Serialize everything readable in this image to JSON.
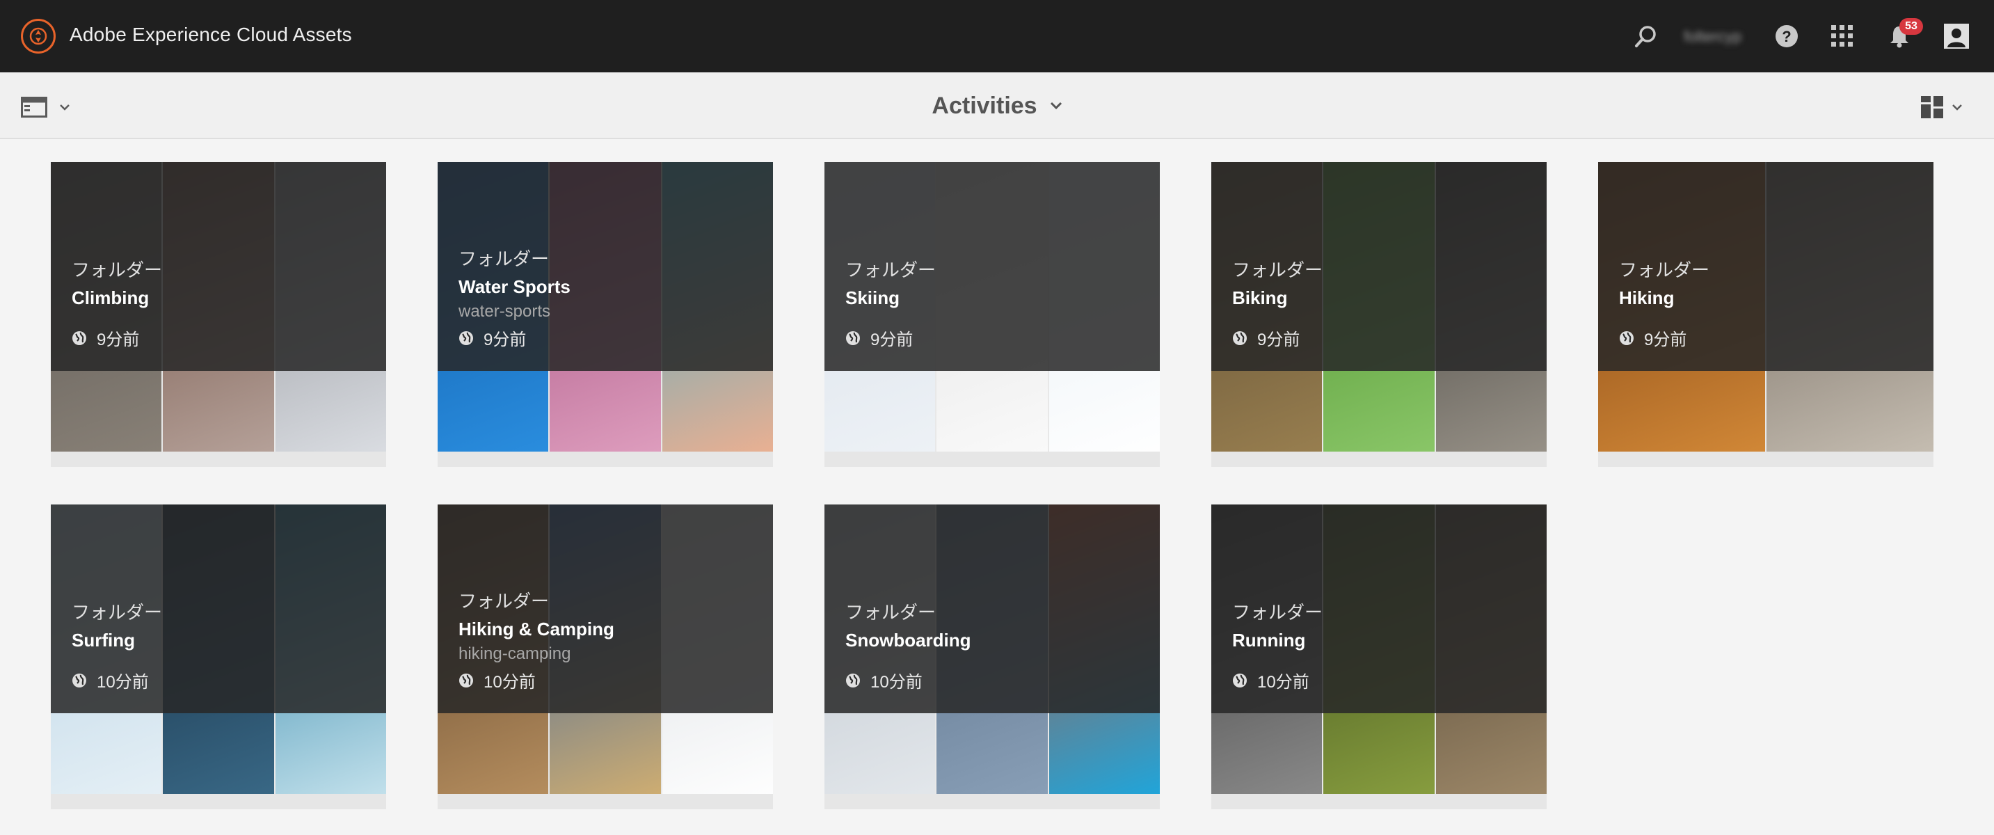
{
  "app": {
    "title": "Adobe Experience Cloud Assets"
  },
  "topbar": {
    "search_icon": "search-icon",
    "user_name": "foltercyp",
    "help_icon": "help-icon",
    "apps_icon": "grid-icon",
    "notifications_count": "53",
    "profile_icon": "user-icon"
  },
  "actionbar": {
    "view_title": "Activities",
    "rail_icon": "rail-toggle-icon",
    "view_icon": "card-view-icon"
  },
  "colors": {
    "accent": "#e8632a",
    "topbar_bg": "#1f1f1f",
    "badge": "#d7373f",
    "overlay": "#282828"
  },
  "cards": [
    {
      "type": "フォルダー",
      "title": "Climbing",
      "subtitle": "",
      "time": "9分前",
      "tiles": [
        [
          "#5a5652",
          "#8a8278"
        ],
        [
          "#6a4a3e",
          "#b8a49c"
        ],
        [
          "#8c8e94",
          "#dcdfe4"
        ]
      ]
    },
    {
      "type": "フォルダー",
      "title": "Water Sports",
      "subtitle": "water-sports",
      "time": "9分前",
      "tiles": [
        [
          "#0e5aa8",
          "#2b8fe0"
        ],
        [
          "#a04a7a",
          "#e0a0c0"
        ],
        [
          "#3aa9c8",
          "#f0b090"
        ]
      ]
    },
    {
      "type": "フォルダー",
      "title": "Skiing",
      "subtitle": "",
      "time": "9分前",
      "tiles": [
        [
          "#d8e0ea",
          "#eef2f6"
        ],
        [
          "#e2e2e2",
          "#fafafa"
        ],
        [
          "#e6eef4",
          "#ffffff"
        ]
      ]
    },
    {
      "type": "フォルダー",
      "title": "Biking",
      "subtitle": "",
      "time": "9分前",
      "tiles": [
        [
          "#5a4a32",
          "#9a8050"
        ],
        [
          "#4a8e2a",
          "#8cc86a"
        ],
        [
          "#3c3a36",
          "#9a948a"
        ]
      ]
    },
    {
      "type": "フォルダー",
      "title": "Hiking",
      "subtitle": "",
      "time": "9分前",
      "tiles": [
        [
          "#7a3e10",
          "#d48a38"
        ],
        [
          "#6a6056",
          "#c8c0b4"
        ]
      ]
    },
    {
      "type": "フォルダー",
      "title": "Surfing",
      "subtitle": "",
      "time": "10分前",
      "tiles": [
        [
          "#b6d2e4",
          "#e6f0f6"
        ],
        [
          "#142a3e",
          "#3a6a88"
        ],
        [
          "#1e7aa0",
          "#c8e4ee"
        ]
      ]
    },
    {
      "type": "フォルダー",
      "title": "Hiking & Camping",
      "subtitle": "hiking-camping",
      "time": "10分前",
      "tiles": [
        [
          "#5a4028",
          "#b89060"
        ],
        [
          "#2a5aa0",
          "#d4b070"
        ],
        [
          "#d8dce0",
          "#ffffff"
        ]
      ]
    },
    {
      "type": "フォルダー",
      "title": "Snowboarding",
      "subtitle": "",
      "time": "10分前",
      "tiles": [
        [
          "#bcc4cc",
          "#e4e8ec"
        ],
        [
          "#5a7088",
          "#8aa0b8"
        ],
        [
          "#c05030",
          "#1aa8e0"
        ]
      ]
    },
    {
      "type": "フォルダー",
      "title": "Running",
      "subtitle": "",
      "time": "10分前",
      "tiles": [
        [
          "#3a3a3a",
          "#8c8c8c"
        ],
        [
          "#3a4a1a",
          "#8aa040"
        ],
        [
          "#4a4030",
          "#a08a6a"
        ]
      ]
    }
  ]
}
